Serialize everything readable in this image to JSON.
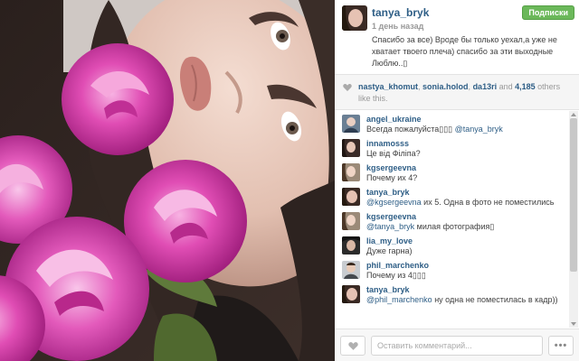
{
  "post": {
    "author": "tanya_bryk",
    "time": "1 день назад",
    "follow_label": "Подписки",
    "caption": "Спасибо за все) Вроде бы только уехал,а уже не хватает твоего плеча) спасибо за эти выходные Люблю..",
    "caption_emoji": "▯"
  },
  "likes": {
    "likers": [
      "nastya_khomut",
      "sonia.holod",
      "da13ri"
    ],
    "separator": ", ",
    "and": " and ",
    "count": "4,185",
    "suffix": " others like this."
  },
  "comments": [
    {
      "user": "angel_ukraine",
      "text": "Всегда пожалуйста▯▯▯ ",
      "mention": "@tanya_bryk",
      "after": ""
    },
    {
      "user": "innamosss",
      "text": "Це від Філіпа?",
      "mention": "",
      "after": ""
    },
    {
      "user": "kgsergeevna",
      "text": "Почему их 4?",
      "mention": "",
      "after": ""
    },
    {
      "user": "tanya_bryk",
      "text": "",
      "mention": "@kgsergeevna",
      "after": " их 5. Одна в фото не поместились"
    },
    {
      "user": "kgsergeevna",
      "text": "",
      "mention": "@tanya_bryk",
      "after": " милая фотография▯"
    },
    {
      "user": "lia_my_love",
      "text": "Дуже гарна)",
      "mention": "",
      "after": ""
    },
    {
      "user": "phil_marchenko",
      "text": "Почему из 4▯▯▯",
      "mention": "",
      "after": ""
    },
    {
      "user": "tanya_bryk",
      "text": "",
      "mention": "@phil_marchenko",
      "after": " ну одна не поместилась в кадр))"
    }
  ],
  "footer": {
    "input_placeholder": "Оставить комментарий...",
    "more_label": "•••"
  },
  "colors": {
    "link": "#2e5e86",
    "follow_button": "#6bb85a",
    "rose": "#d63aa8"
  },
  "icons": {
    "like_heart": "heart-icon",
    "more": "ellipsis-icon"
  }
}
